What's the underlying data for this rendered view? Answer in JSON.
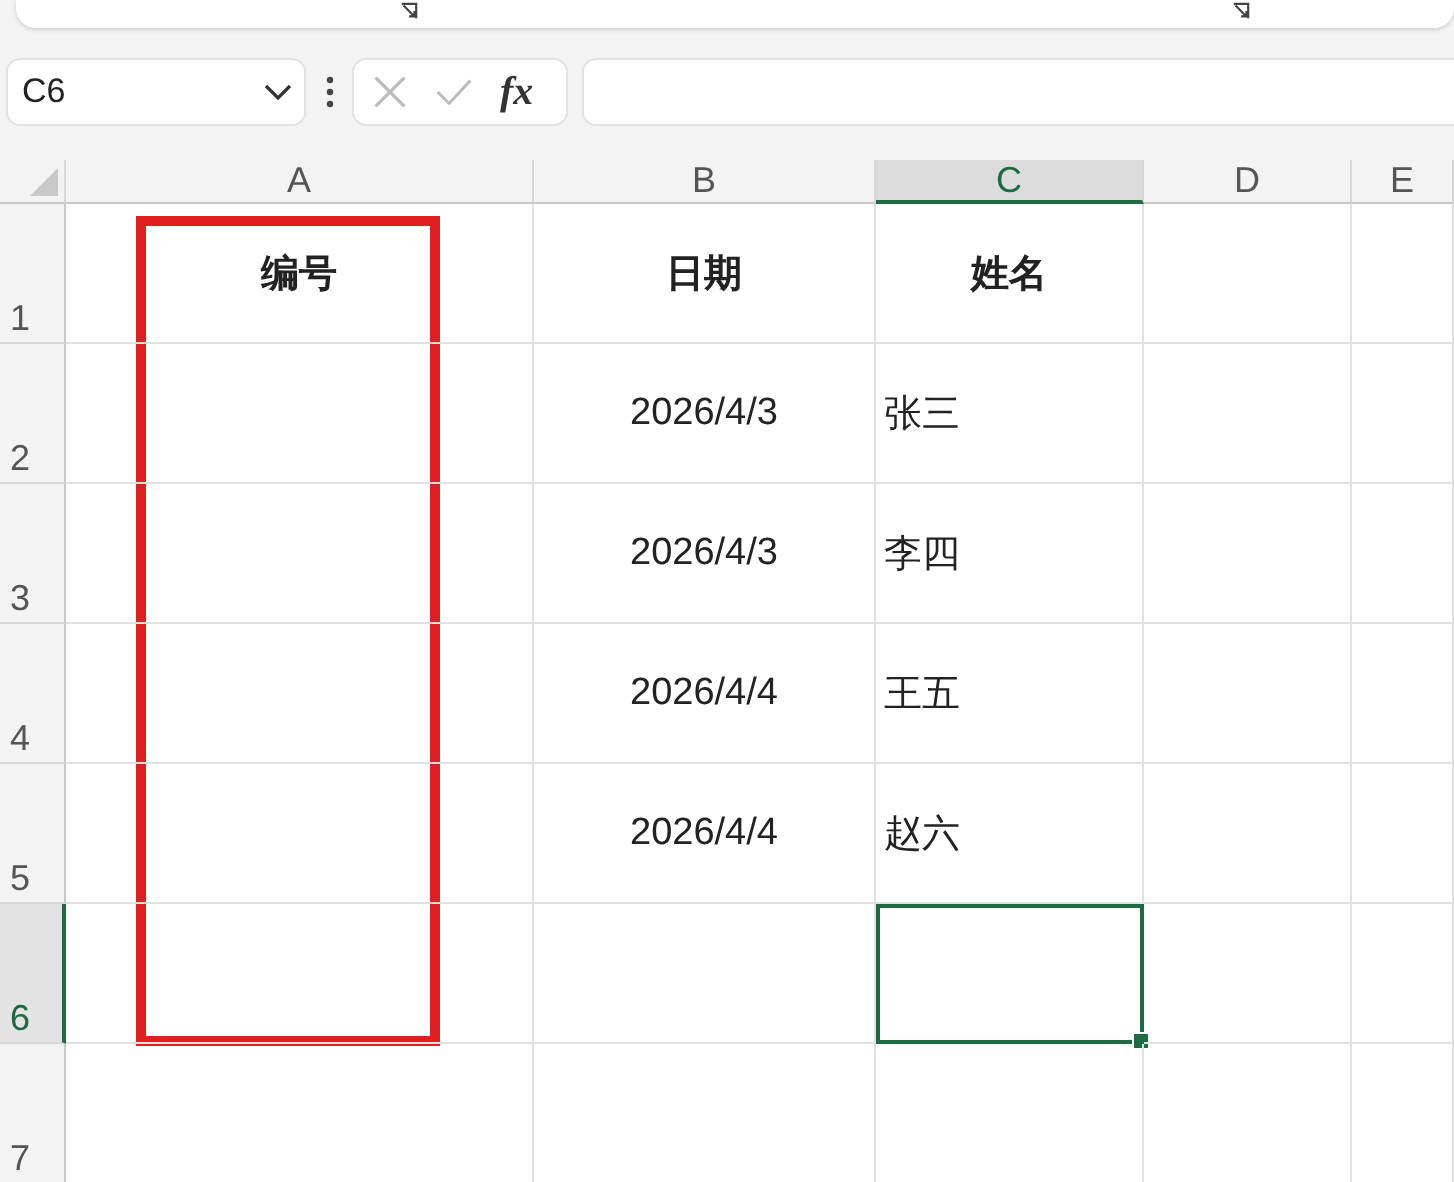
{
  "name_box": {
    "value": "C6"
  },
  "formula_bar": {
    "fx": "fx"
  },
  "columns": [
    {
      "letter": "A",
      "selected": false,
      "highlighted": true
    },
    {
      "letter": "B",
      "selected": false,
      "highlighted": false
    },
    {
      "letter": "C",
      "selected": true,
      "highlighted": false
    },
    {
      "letter": "D",
      "selected": false,
      "highlighted": false
    },
    {
      "letter": "E",
      "selected": false,
      "highlighted": false
    }
  ],
  "rows": [
    {
      "number": "1",
      "selected": false,
      "highlighted": true,
      "cells": [
        {
          "kind": "header",
          "text": "编号"
        },
        {
          "kind": "header",
          "text": "日期"
        },
        {
          "kind": "header",
          "text": "姓名"
        }
      ]
    },
    {
      "number": "2",
      "selected": false,
      "highlighted": true,
      "cells": [
        {
          "kind": "empty"
        },
        {
          "kind": "date",
          "text": "2026/4/3"
        },
        {
          "kind": "text",
          "text": "张三"
        }
      ]
    },
    {
      "number": "3",
      "selected": false,
      "highlighted": true,
      "cells": [
        {
          "kind": "empty"
        },
        {
          "kind": "date",
          "text": "2026/4/3"
        },
        {
          "kind": "text",
          "text": "李四"
        }
      ]
    },
    {
      "number": "4",
      "selected": false,
      "highlighted": true,
      "cells": [
        {
          "kind": "empty"
        },
        {
          "kind": "date",
          "text": "2026/4/4"
        },
        {
          "kind": "text",
          "text": "王五"
        }
      ]
    },
    {
      "number": "5",
      "selected": false,
      "highlighted": true,
      "cells": [
        {
          "kind": "empty"
        },
        {
          "kind": "date",
          "text": "2026/4/4"
        },
        {
          "kind": "text",
          "text": "赵六"
        }
      ]
    },
    {
      "number": "6",
      "selected": true,
      "highlighted": true
    },
    {
      "number": "7",
      "selected": false,
      "highlighted": false
    }
  ]
}
